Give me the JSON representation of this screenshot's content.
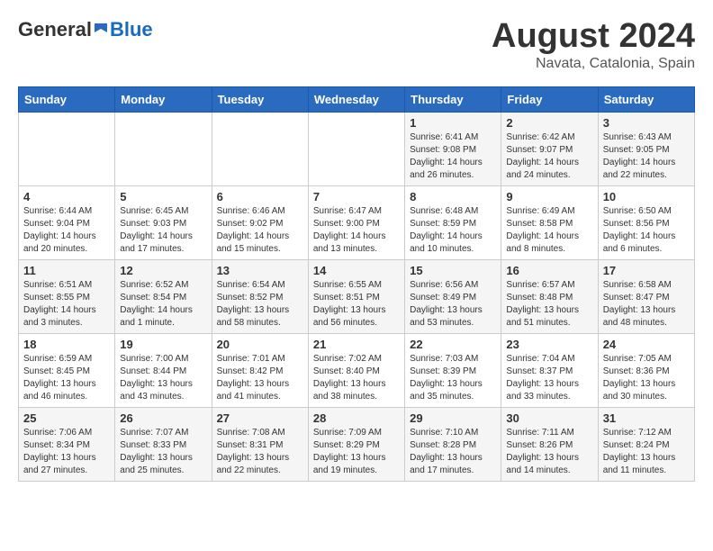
{
  "logo": {
    "general": "General",
    "blue": "Blue"
  },
  "title": "August 2024",
  "location": "Navata, Catalonia, Spain",
  "days_of_week": [
    "Sunday",
    "Monday",
    "Tuesday",
    "Wednesday",
    "Thursday",
    "Friday",
    "Saturday"
  ],
  "weeks": [
    [
      {
        "num": "",
        "info": ""
      },
      {
        "num": "",
        "info": ""
      },
      {
        "num": "",
        "info": ""
      },
      {
        "num": "",
        "info": ""
      },
      {
        "num": "1",
        "info": "Sunrise: 6:41 AM\nSunset: 9:08 PM\nDaylight: 14 hours and 26 minutes."
      },
      {
        "num": "2",
        "info": "Sunrise: 6:42 AM\nSunset: 9:07 PM\nDaylight: 14 hours and 24 minutes."
      },
      {
        "num": "3",
        "info": "Sunrise: 6:43 AM\nSunset: 9:05 PM\nDaylight: 14 hours and 22 minutes."
      }
    ],
    [
      {
        "num": "4",
        "info": "Sunrise: 6:44 AM\nSunset: 9:04 PM\nDaylight: 14 hours and 20 minutes."
      },
      {
        "num": "5",
        "info": "Sunrise: 6:45 AM\nSunset: 9:03 PM\nDaylight: 14 hours and 17 minutes."
      },
      {
        "num": "6",
        "info": "Sunrise: 6:46 AM\nSunset: 9:02 PM\nDaylight: 14 hours and 15 minutes."
      },
      {
        "num": "7",
        "info": "Sunrise: 6:47 AM\nSunset: 9:00 PM\nDaylight: 14 hours and 13 minutes."
      },
      {
        "num": "8",
        "info": "Sunrise: 6:48 AM\nSunset: 8:59 PM\nDaylight: 14 hours and 10 minutes."
      },
      {
        "num": "9",
        "info": "Sunrise: 6:49 AM\nSunset: 8:58 PM\nDaylight: 14 hours and 8 minutes."
      },
      {
        "num": "10",
        "info": "Sunrise: 6:50 AM\nSunset: 8:56 PM\nDaylight: 14 hours and 6 minutes."
      }
    ],
    [
      {
        "num": "11",
        "info": "Sunrise: 6:51 AM\nSunset: 8:55 PM\nDaylight: 14 hours and 3 minutes."
      },
      {
        "num": "12",
        "info": "Sunrise: 6:52 AM\nSunset: 8:54 PM\nDaylight: 14 hours and 1 minute."
      },
      {
        "num": "13",
        "info": "Sunrise: 6:54 AM\nSunset: 8:52 PM\nDaylight: 13 hours and 58 minutes."
      },
      {
        "num": "14",
        "info": "Sunrise: 6:55 AM\nSunset: 8:51 PM\nDaylight: 13 hours and 56 minutes."
      },
      {
        "num": "15",
        "info": "Sunrise: 6:56 AM\nSunset: 8:49 PM\nDaylight: 13 hours and 53 minutes."
      },
      {
        "num": "16",
        "info": "Sunrise: 6:57 AM\nSunset: 8:48 PM\nDaylight: 13 hours and 51 minutes."
      },
      {
        "num": "17",
        "info": "Sunrise: 6:58 AM\nSunset: 8:47 PM\nDaylight: 13 hours and 48 minutes."
      }
    ],
    [
      {
        "num": "18",
        "info": "Sunrise: 6:59 AM\nSunset: 8:45 PM\nDaylight: 13 hours and 46 minutes."
      },
      {
        "num": "19",
        "info": "Sunrise: 7:00 AM\nSunset: 8:44 PM\nDaylight: 13 hours and 43 minutes."
      },
      {
        "num": "20",
        "info": "Sunrise: 7:01 AM\nSunset: 8:42 PM\nDaylight: 13 hours and 41 minutes."
      },
      {
        "num": "21",
        "info": "Sunrise: 7:02 AM\nSunset: 8:40 PM\nDaylight: 13 hours and 38 minutes."
      },
      {
        "num": "22",
        "info": "Sunrise: 7:03 AM\nSunset: 8:39 PM\nDaylight: 13 hours and 35 minutes."
      },
      {
        "num": "23",
        "info": "Sunrise: 7:04 AM\nSunset: 8:37 PM\nDaylight: 13 hours and 33 minutes."
      },
      {
        "num": "24",
        "info": "Sunrise: 7:05 AM\nSunset: 8:36 PM\nDaylight: 13 hours and 30 minutes."
      }
    ],
    [
      {
        "num": "25",
        "info": "Sunrise: 7:06 AM\nSunset: 8:34 PM\nDaylight: 13 hours and 27 minutes."
      },
      {
        "num": "26",
        "info": "Sunrise: 7:07 AM\nSunset: 8:33 PM\nDaylight: 13 hours and 25 minutes."
      },
      {
        "num": "27",
        "info": "Sunrise: 7:08 AM\nSunset: 8:31 PM\nDaylight: 13 hours and 22 minutes."
      },
      {
        "num": "28",
        "info": "Sunrise: 7:09 AM\nSunset: 8:29 PM\nDaylight: 13 hours and 19 minutes."
      },
      {
        "num": "29",
        "info": "Sunrise: 7:10 AM\nSunset: 8:28 PM\nDaylight: 13 hours and 17 minutes."
      },
      {
        "num": "30",
        "info": "Sunrise: 7:11 AM\nSunset: 8:26 PM\nDaylight: 13 hours and 14 minutes."
      },
      {
        "num": "31",
        "info": "Sunrise: 7:12 AM\nSunset: 8:24 PM\nDaylight: 13 hours and 11 minutes."
      }
    ]
  ]
}
